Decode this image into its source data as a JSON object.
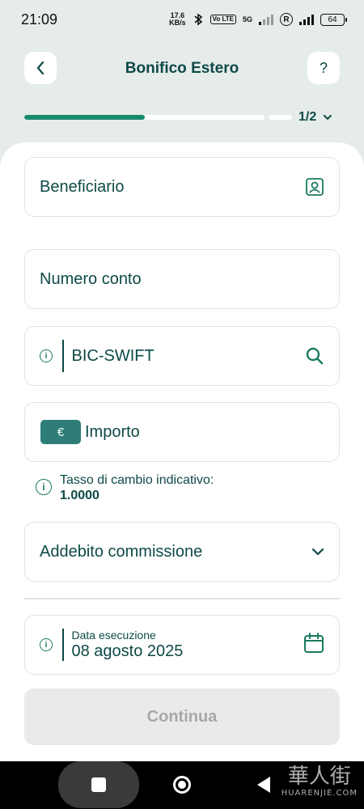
{
  "status_bar": {
    "time": "21:09",
    "speed_value": "17.6",
    "speed_unit": "KB/s",
    "volte_label": "Vo LTE",
    "network_label": "5G",
    "battery_level": "64"
  },
  "header": {
    "title": "Bonifico Estero",
    "help_label": "?"
  },
  "progress": {
    "step_label": "1/2",
    "fraction": 0.5
  },
  "form": {
    "beneficiario_label": "Beneficiario",
    "numero_conto_placeholder": "Numero conto",
    "bic_placeholder": "BIC-SWIFT",
    "currency_symbol": "€",
    "importo_placeholder": "Importo",
    "exchange_rate_label": "Tasso di cambio indicativo:",
    "exchange_rate_value": "1.0000",
    "addebito_label": "Addebito commissione",
    "data_label": "Data esecuzione",
    "data_value": "08 agosto 2025",
    "continue_label": "Continua"
  },
  "watermark": {
    "cjk": "華人街",
    "latin": "HUARENJIE.COM"
  },
  "colors": {
    "primary": "#0d4a46",
    "accent": "#1a8a6c",
    "background": "#e6ecea",
    "currency_badge": "#2e7d78"
  }
}
